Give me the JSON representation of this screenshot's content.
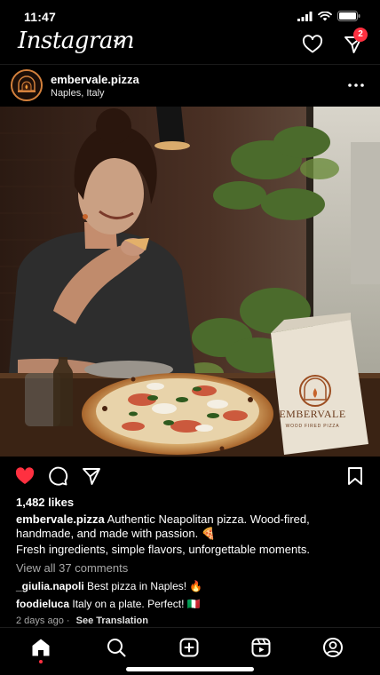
{
  "status": {
    "time": "11:47"
  },
  "header": {
    "logo": "Instagram",
    "notification_count": "2"
  },
  "post": {
    "username": "embervale.pizza",
    "location": "Naples, Italy",
    "likes": "1,482 likes",
    "caption_user": "embervale.pizza",
    "caption_text": "Authentic Neapolitan pizza. Wood-fired, handmade, and made with passion. 🍕",
    "caption_line2": "Fresh ingredients, simple flavors, unforgettable moments.",
    "view_comments": "View all 37 comments",
    "comments": [
      {
        "user": "_giulia.napoli",
        "text": "Best pizza in Naples! 🔥"
      },
      {
        "user": "foodieluca",
        "text": "Italy on a plate. Perfect! 🇮🇹"
      }
    ],
    "time_ago": "2 days ago",
    "dot": "·",
    "see_translation": "See Translation",
    "box_brand": "EMBERVALE",
    "box_sub": "WOOD FIRED PIZZA"
  },
  "colors": {
    "like_red": "#ff3040",
    "accent_orange": "#d4813c",
    "background": "#000000"
  },
  "icons": {
    "status": [
      "signal-icon",
      "wifi-icon",
      "battery-icon"
    ],
    "header": [
      "chevron-down-icon",
      "heart-outline-icon",
      "send-icon"
    ],
    "post_actions": [
      "heart-filled-icon",
      "comment-icon",
      "share-icon",
      "bookmark-icon"
    ],
    "tabs": [
      "home-icon",
      "search-icon",
      "create-icon",
      "reels-icon",
      "profile-icon"
    ]
  }
}
